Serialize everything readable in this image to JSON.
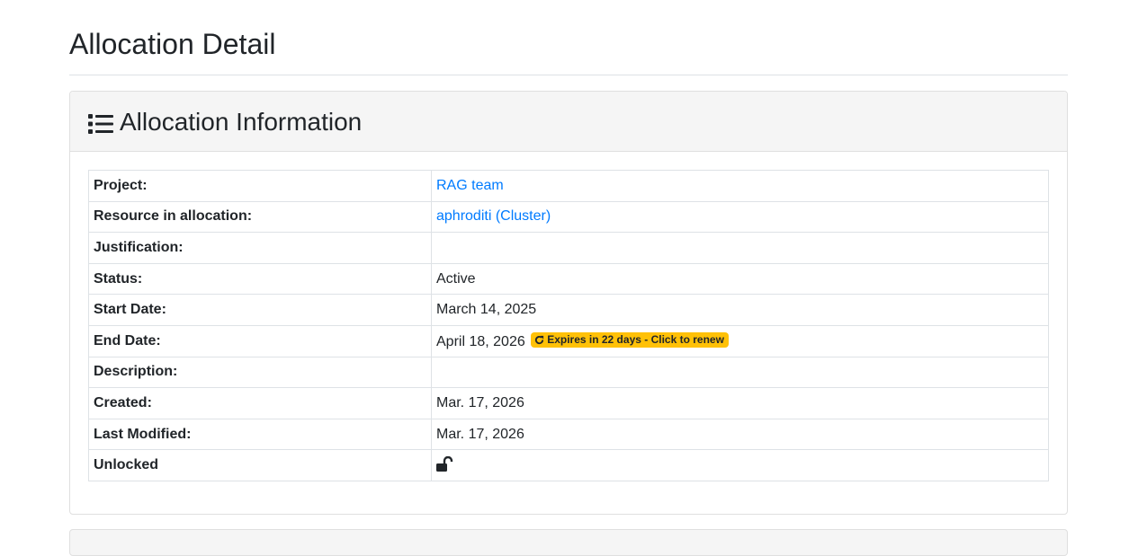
{
  "page": {
    "title": "Allocation Detail"
  },
  "card": {
    "title": "Allocation Information",
    "icon": "list-icon"
  },
  "rows": {
    "project": {
      "label": "Project:",
      "value": "RAG team"
    },
    "resource": {
      "label": "Resource in allocation:",
      "value": "aphroditi (Cluster)"
    },
    "justification": {
      "label": "Justification:",
      "value": ""
    },
    "status": {
      "label": "Status:",
      "value": "Active"
    },
    "start_date": {
      "label": "Start Date:",
      "value": "March 14, 2025"
    },
    "end_date": {
      "label": "End Date:",
      "value": "April 18, 2026",
      "badge": "Expires in 22 days - Click to renew",
      "badge_icon": "refresh-icon",
      "badge_color": "#ffc107"
    },
    "description": {
      "label": "Description:",
      "value": ""
    },
    "created": {
      "label": "Created:",
      "value": "Mar. 17, 2026"
    },
    "last_modified": {
      "label": "Last Modified:",
      "value": "Mar. 17, 2026"
    },
    "unlocked": {
      "label": "Unlocked",
      "icon": "unlock-icon"
    }
  },
  "colors": {
    "link": "#007bff",
    "header_bg": "#f5f5f5",
    "badge_warning": "#ffc107"
  }
}
